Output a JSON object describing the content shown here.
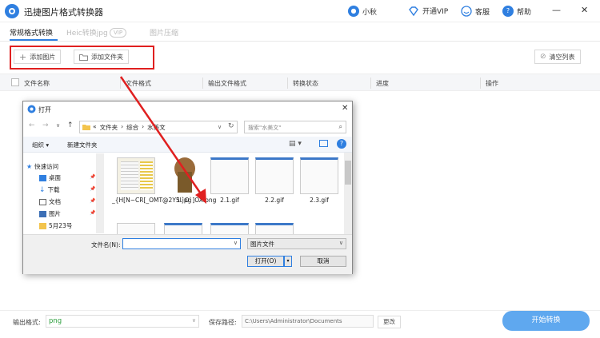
{
  "app": {
    "title": "迅捷图片格式转换器",
    "user": "小秋",
    "vip": "开通VIP",
    "service": "客服",
    "help": "帮助"
  },
  "tabs": [
    {
      "label": "常规格式转换",
      "active": true
    },
    {
      "label": "Heic转换jpg",
      "badge": "VIP",
      "active": false
    },
    {
      "label": "图片压缩",
      "active": false
    }
  ],
  "toolbar": {
    "add_image": "添加图片",
    "add_folder": "添加文件夹",
    "clear_list": "清空列表"
  },
  "table": {
    "columns": [
      "文件名称",
      "文件格式",
      "输出文件格式",
      "转换状态",
      "进度",
      "操作"
    ]
  },
  "footer": {
    "format_label": "输出格式:",
    "format_value": "png",
    "path_label": "保存路径:",
    "path_value": "C:\\Users\\Administrator\\Documents",
    "change_label": "更改",
    "start_label": "开始转换"
  },
  "dialog": {
    "title": "打开",
    "breadcrumb": [
      "«",
      "文件夹",
      "综合",
      "水美文"
    ],
    "search_placeholder": "搜索\"水美文\"",
    "organize": "组织 ▾",
    "new_folder": "新建文件夹",
    "nav_items": [
      "快速访问",
      "桌面",
      "下载",
      "文档",
      "图片",
      "5月23号"
    ],
    "files": [
      {
        "name": "_{H[N~CR[_OMT@2Y5I`O`]OX.png"
      },
      {
        "name": "1.jpg"
      },
      {
        "name": "2.1.gif"
      },
      {
        "name": "2.2.gif"
      },
      {
        "name": "2.3.gif"
      }
    ],
    "filename_label": "文件名(N):",
    "filename_value": "",
    "filetype_value": "图片文件",
    "open_button": "打开(O)",
    "cancel_button": "取消"
  },
  "colors": {
    "accent": "#2f7fe0",
    "highlight_red": "#e02020",
    "start_button": "#5fa8ef",
    "format_value": "#2e9f3e"
  }
}
